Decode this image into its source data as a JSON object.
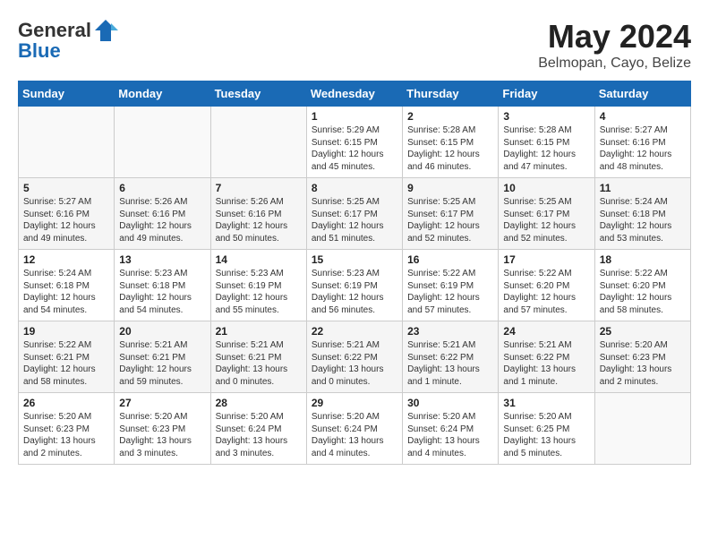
{
  "header": {
    "logo_general": "General",
    "logo_blue": "Blue",
    "month_year": "May 2024",
    "location": "Belmopan, Cayo, Belize"
  },
  "days_of_week": [
    "Sunday",
    "Monday",
    "Tuesday",
    "Wednesday",
    "Thursday",
    "Friday",
    "Saturday"
  ],
  "weeks": [
    [
      {
        "day": "",
        "info": ""
      },
      {
        "day": "",
        "info": ""
      },
      {
        "day": "",
        "info": ""
      },
      {
        "day": "1",
        "info": "Sunrise: 5:29 AM\nSunset: 6:15 PM\nDaylight: 12 hours\nand 45 minutes."
      },
      {
        "day": "2",
        "info": "Sunrise: 5:28 AM\nSunset: 6:15 PM\nDaylight: 12 hours\nand 46 minutes."
      },
      {
        "day": "3",
        "info": "Sunrise: 5:28 AM\nSunset: 6:15 PM\nDaylight: 12 hours\nand 47 minutes."
      },
      {
        "day": "4",
        "info": "Sunrise: 5:27 AM\nSunset: 6:16 PM\nDaylight: 12 hours\nand 48 minutes."
      }
    ],
    [
      {
        "day": "5",
        "info": "Sunrise: 5:27 AM\nSunset: 6:16 PM\nDaylight: 12 hours\nand 49 minutes."
      },
      {
        "day": "6",
        "info": "Sunrise: 5:26 AM\nSunset: 6:16 PM\nDaylight: 12 hours\nand 49 minutes."
      },
      {
        "day": "7",
        "info": "Sunrise: 5:26 AM\nSunset: 6:16 PM\nDaylight: 12 hours\nand 50 minutes."
      },
      {
        "day": "8",
        "info": "Sunrise: 5:25 AM\nSunset: 6:17 PM\nDaylight: 12 hours\nand 51 minutes."
      },
      {
        "day": "9",
        "info": "Sunrise: 5:25 AM\nSunset: 6:17 PM\nDaylight: 12 hours\nand 52 minutes."
      },
      {
        "day": "10",
        "info": "Sunrise: 5:25 AM\nSunset: 6:17 PM\nDaylight: 12 hours\nand 52 minutes."
      },
      {
        "day": "11",
        "info": "Sunrise: 5:24 AM\nSunset: 6:18 PM\nDaylight: 12 hours\nand 53 minutes."
      }
    ],
    [
      {
        "day": "12",
        "info": "Sunrise: 5:24 AM\nSunset: 6:18 PM\nDaylight: 12 hours\nand 54 minutes."
      },
      {
        "day": "13",
        "info": "Sunrise: 5:23 AM\nSunset: 6:18 PM\nDaylight: 12 hours\nand 54 minutes."
      },
      {
        "day": "14",
        "info": "Sunrise: 5:23 AM\nSunset: 6:19 PM\nDaylight: 12 hours\nand 55 minutes."
      },
      {
        "day": "15",
        "info": "Sunrise: 5:23 AM\nSunset: 6:19 PM\nDaylight: 12 hours\nand 56 minutes."
      },
      {
        "day": "16",
        "info": "Sunrise: 5:22 AM\nSunset: 6:19 PM\nDaylight: 12 hours\nand 57 minutes."
      },
      {
        "day": "17",
        "info": "Sunrise: 5:22 AM\nSunset: 6:20 PM\nDaylight: 12 hours\nand 57 minutes."
      },
      {
        "day": "18",
        "info": "Sunrise: 5:22 AM\nSunset: 6:20 PM\nDaylight: 12 hours\nand 58 minutes."
      }
    ],
    [
      {
        "day": "19",
        "info": "Sunrise: 5:22 AM\nSunset: 6:21 PM\nDaylight: 12 hours\nand 58 minutes."
      },
      {
        "day": "20",
        "info": "Sunrise: 5:21 AM\nSunset: 6:21 PM\nDaylight: 12 hours\nand 59 minutes."
      },
      {
        "day": "21",
        "info": "Sunrise: 5:21 AM\nSunset: 6:21 PM\nDaylight: 13 hours\nand 0 minutes."
      },
      {
        "day": "22",
        "info": "Sunrise: 5:21 AM\nSunset: 6:22 PM\nDaylight: 13 hours\nand 0 minutes."
      },
      {
        "day": "23",
        "info": "Sunrise: 5:21 AM\nSunset: 6:22 PM\nDaylight: 13 hours\nand 1 minute."
      },
      {
        "day": "24",
        "info": "Sunrise: 5:21 AM\nSunset: 6:22 PM\nDaylight: 13 hours\nand 1 minute."
      },
      {
        "day": "25",
        "info": "Sunrise: 5:20 AM\nSunset: 6:23 PM\nDaylight: 13 hours\nand 2 minutes."
      }
    ],
    [
      {
        "day": "26",
        "info": "Sunrise: 5:20 AM\nSunset: 6:23 PM\nDaylight: 13 hours\nand 2 minutes."
      },
      {
        "day": "27",
        "info": "Sunrise: 5:20 AM\nSunset: 6:23 PM\nDaylight: 13 hours\nand 3 minutes."
      },
      {
        "day": "28",
        "info": "Sunrise: 5:20 AM\nSunset: 6:24 PM\nDaylight: 13 hours\nand 3 minutes."
      },
      {
        "day": "29",
        "info": "Sunrise: 5:20 AM\nSunset: 6:24 PM\nDaylight: 13 hours\nand 4 minutes."
      },
      {
        "day": "30",
        "info": "Sunrise: 5:20 AM\nSunset: 6:24 PM\nDaylight: 13 hours\nand 4 minutes."
      },
      {
        "day": "31",
        "info": "Sunrise: 5:20 AM\nSunset: 6:25 PM\nDaylight: 13 hours\nand 5 minutes."
      },
      {
        "day": "",
        "info": ""
      }
    ]
  ]
}
